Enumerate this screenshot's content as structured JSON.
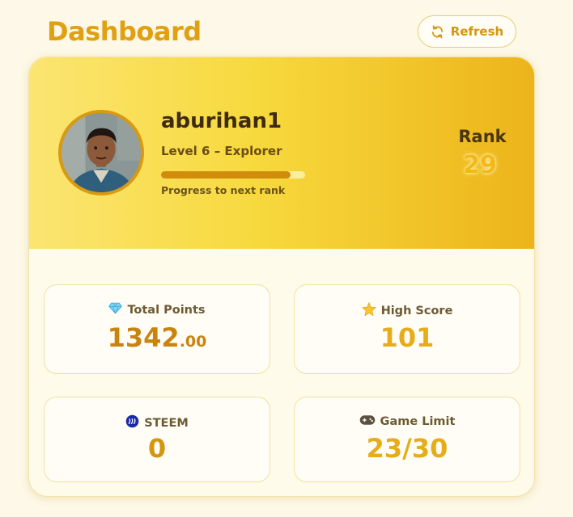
{
  "header": {
    "title": "Dashboard",
    "refresh_label": "Refresh",
    "refresh_icon": "refresh-icon"
  },
  "profile": {
    "username": "aburihan1",
    "level_text": "Level 6 – Explorer",
    "progress_label": "Progress to next rank",
    "progress_fraction": 0.9,
    "rank_label": "Rank",
    "rank_value": "29"
  },
  "stats": {
    "total_points": {
      "label": "Total Points",
      "icon": "gem-icon",
      "value_int": "1342",
      "value_dec": ".00"
    },
    "high_score": {
      "label": "High Score",
      "icon": "star-icon",
      "value": "101"
    },
    "steem": {
      "label": "STEEM",
      "icon": "steem-icon",
      "value": "0"
    },
    "game_limit": {
      "label": "Game Limit",
      "icon": "gamepad-icon",
      "value": "23/30"
    }
  },
  "colors": {
    "accent": "#e0a012",
    "hero_start": "#fbe572",
    "hero_end": "#ecb41a",
    "background": "#fdf8e7"
  }
}
